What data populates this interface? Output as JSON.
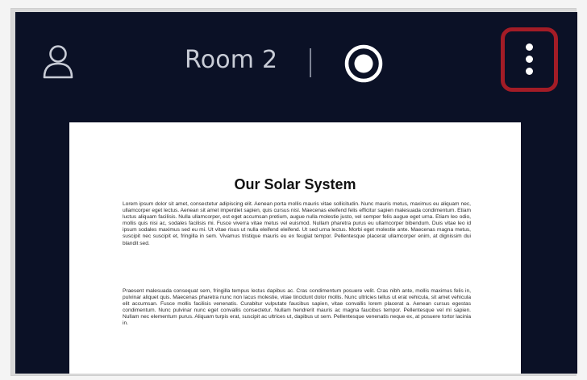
{
  "header": {
    "user_icon": "user-icon",
    "room_title": "Room 2",
    "record_icon": "record-icon",
    "more_icon": "more-vertical-icon",
    "highlight_color": "#a31c26",
    "background_color": "#0b1126"
  },
  "document": {
    "title": "Our Solar System",
    "paragraphs": [
      "Lorem ipsum dolor sit amet, consectetur adipiscing elit. Aenean porta mollis mauris vitae sollicitudin. Nunc mauris metus, maximus eu aliquam nec, ullamcorper eget lectus. Aenean sit amet imperdiet sapien, quis cursus nisl. Maecenas eleifend felis efficitur sapien malesuada condimentum. Etiam luctus aliquam facilisis. Nulla ullamcorper, est eget accumsan pretium, augue nulla molestie justo, vel semper felis augue eget urna. Etiam leo odio, mollis quis nisi ac, sodales facilisis mi. Fusce viverra vitae metus vel euismod. Nullam pharetra purus eu ullamcorper bibendum. Duis vitae leo id ipsum sodales maximus sed eu mi. Ut vitae risus ut nulla eleifend eleifend. Ut sed urna lectus. Morbi eget molestie ante. Maecenas magna metus, suscipit nec suscipit et, fringilla in sem. Vivamus tristique mauris eu ex feugiat tempor. Pellentesque placerat ullamcorper enim, at dignissim dui blandit sed.",
      "Praesent malesuada consequat sem, fringilla tempus lectus dapibus ac. Cras condimentum posuere velit. Cras nibh ante, mollis maximus felis in, pulvinar aliquet quis. Maecenas pharetra nunc non lacus molestie, vitae tincidunt dolor mollis. Nunc ultricies tellus ut erat vehicula, sit amet vehicula elit accumsan. Fusce mollis facilisis venenatis. Curabitur vulputate faucibus sapien, vitae convallis lorem placerat a. Aenean cursus egestas condimentum. Nunc pulvinar nunc eget convallis consectetur. Nullam hendrerit mauris ac magna faucibus tempor. Pellentesque vel mi sapien. Nullam nec elementum purus. Aliquam turpis erat, suscipit ac ultrices ut, dapibus ut sem. Pellentesque venenatis neque ex, at posuere tortor lacinia in."
    ]
  }
}
